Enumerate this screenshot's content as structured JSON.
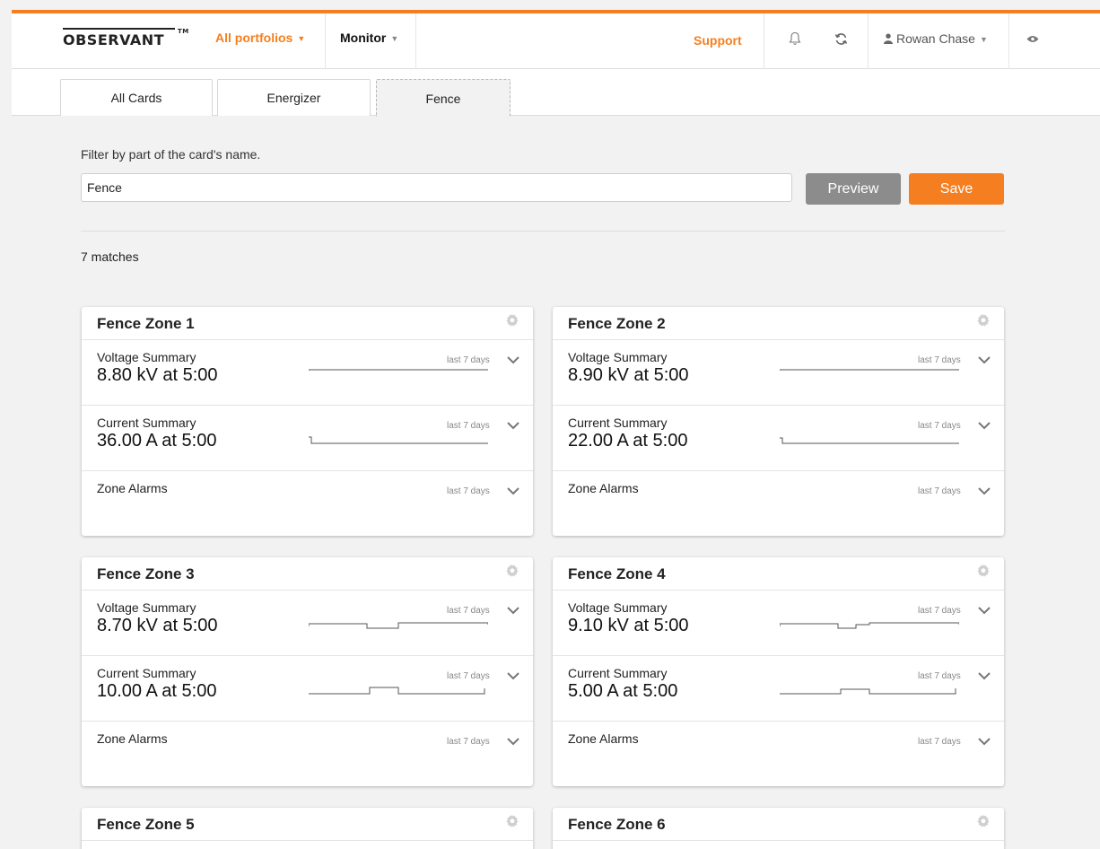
{
  "brand": {
    "logo": "OBSERVANT",
    "trademark": "TM"
  },
  "nav": {
    "portfolios": "All portfolios",
    "monitor": "Monitor",
    "support": "Support",
    "user": "Rowan Chase"
  },
  "icons": [
    "bell-icon",
    "refresh-icon",
    "user-icon",
    "eye-icon",
    "gear-icon",
    "chevron-down-icon"
  ],
  "colors": {
    "accent": "#f57f20",
    "preview_button": "#8c8c8c"
  },
  "tabs": [
    {
      "label": "All Cards",
      "active": false
    },
    {
      "label": "Energizer",
      "active": false
    },
    {
      "label": "Fence",
      "active": true
    }
  ],
  "filter": {
    "label": "Filter by part of the card's name.",
    "value": "Fence",
    "preview_label": "Preview",
    "save_label": "Save"
  },
  "matches": "7 matches",
  "cards": [
    {
      "title": "Fence Zone 1",
      "rows": [
        {
          "label": "Voltage Summary",
          "value": "8.80 kV at 5:00",
          "range": "last 7 days"
        },
        {
          "label": "Current Summary",
          "value": "36.00 A at 5:00",
          "range": "last 7 days"
        },
        {
          "label": "Zone Alarms",
          "value": "",
          "range": "last 7 days"
        }
      ]
    },
    {
      "title": "Fence Zone 2",
      "rows": [
        {
          "label": "Voltage Summary",
          "value": "8.90 kV at 5:00",
          "range": "last 7 days"
        },
        {
          "label": "Current Summary",
          "value": "22.00 A at 5:00",
          "range": "last 7 days"
        },
        {
          "label": "Zone Alarms",
          "value": "",
          "range": "last 7 days"
        }
      ]
    },
    {
      "title": "Fence Zone 3",
      "rows": [
        {
          "label": "Voltage Summary",
          "value": "8.70 kV at 5:00",
          "range": "last 7 days"
        },
        {
          "label": "Current Summary",
          "value": "10.00 A at 5:00",
          "range": "last 7 days"
        },
        {
          "label": "Zone Alarms",
          "value": "",
          "range": "last 7 days"
        }
      ]
    },
    {
      "title": "Fence Zone 4",
      "rows": [
        {
          "label": "Voltage Summary",
          "value": "9.10 kV at 5:00",
          "range": "last 7 days"
        },
        {
          "label": "Current Summary",
          "value": "5.00 A at 5:00",
          "range": "last 7 days"
        },
        {
          "label": "Zone Alarms",
          "value": "",
          "range": "last 7 days"
        }
      ]
    },
    {
      "title": "Fence Zone 5",
      "rows": []
    },
    {
      "title": "Fence Zone 6",
      "rows": []
    }
  ]
}
